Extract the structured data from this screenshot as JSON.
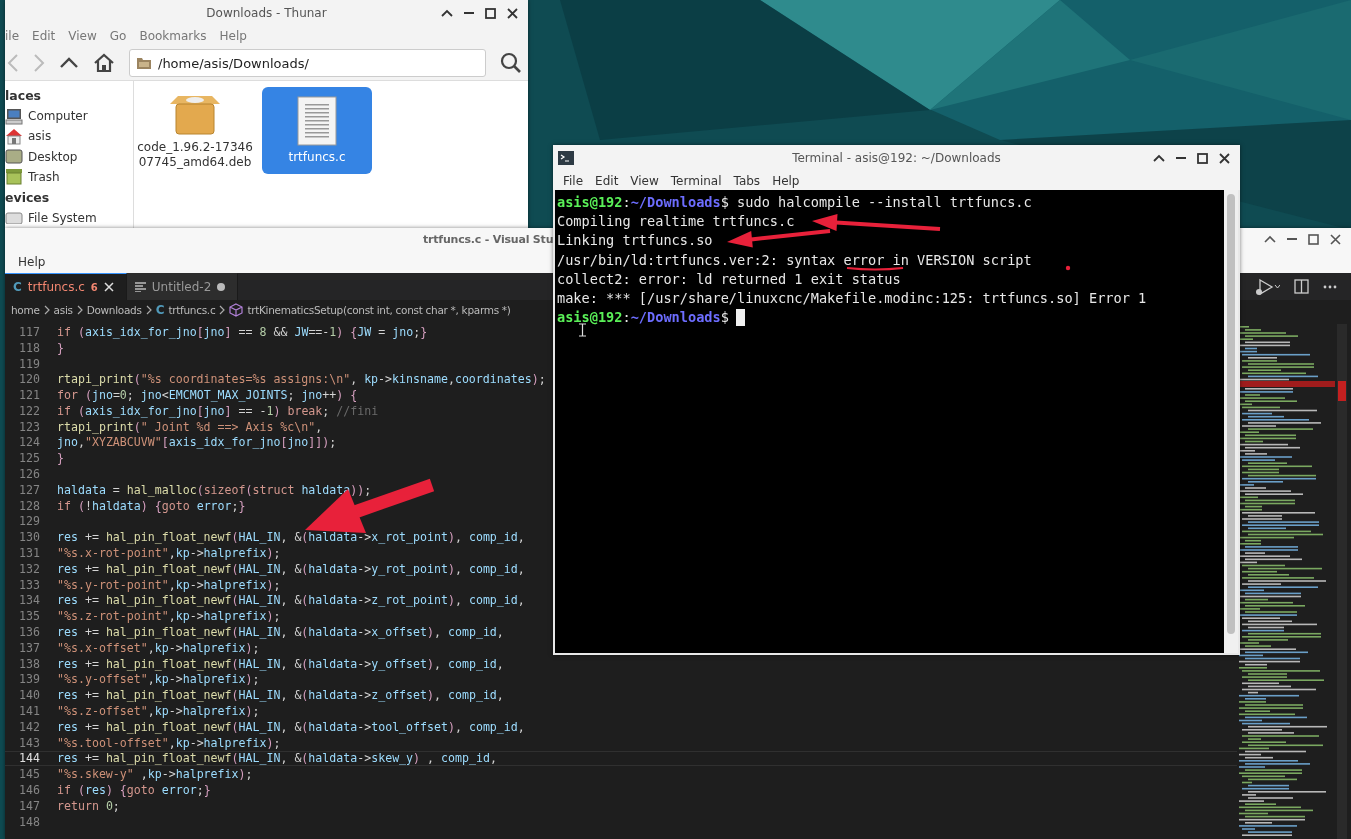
{
  "thunar": {
    "title": "Downloads - Thunar",
    "menu": [
      "ile",
      "Edit",
      "View",
      "Go",
      "Bookmarks",
      "Help"
    ],
    "location": "/home/asis/Downloads/",
    "sidebar": [
      {
        "kind": "header",
        "label": "laces"
      },
      {
        "kind": "item",
        "label": "Computer"
      },
      {
        "kind": "item",
        "label": "asis"
      },
      {
        "kind": "item",
        "label": "Desktop"
      },
      {
        "kind": "item",
        "label": "Trash"
      },
      {
        "kind": "header",
        "label": "evices"
      },
      {
        "kind": "item",
        "label": "File System"
      }
    ],
    "files": [
      {
        "name_lines": [
          "code_1.96.2-17346",
          "07745_amd64.deb"
        ],
        "selected": false
      },
      {
        "name_lines": [
          "trtfuncs.c"
        ],
        "selected": true
      }
    ]
  },
  "vscode": {
    "title": "trtfuncs.c - Visual Stu",
    "menu": [
      "Help"
    ],
    "tabs": [
      {
        "icon_text": "C",
        "label": "trtfuncs.c",
        "badge": "6",
        "selected": true,
        "modified": false
      },
      {
        "label": "Untitled-2",
        "selected": false,
        "modified": true
      }
    ],
    "breadcrumb": [
      {
        "kind": "folder",
        "label": "home"
      },
      {
        "kind": "folder",
        "label": "asis"
      },
      {
        "kind": "folder",
        "label": "Downloads"
      },
      {
        "kind": "file",
        "icon_text": "C",
        "label": "trtfuncs.c"
      },
      {
        "kind": "symbol",
        "label": "trtKinematicsSetup(const int, const char *, kparms *)"
      }
    ],
    "lines": [
      {
        "number": "117",
        "code": "if (axis_idx_for_jno[jno] == 8 && JW==-1) {JW = jno;}",
        "current": false
      },
      {
        "number": "118",
        "code": "}",
        "current": false
      },
      {
        "number": "119",
        "current": false
      },
      {
        "number": "120",
        "code": "rtapi_print(\"%s coordinates=%s assigns:\\n\", kp->kinsname,coordinates);",
        "current": false
      },
      {
        "number": "121",
        "code": "for (jno=0; jno<EMCMOT_MAX_JOINTS; jno++) {",
        "current": false
      },
      {
        "number": "122",
        "code": "if (axis_idx_for_jno[jno] == -1) break; //fini",
        "current": false
      },
      {
        "number": "123",
        "code": "rtapi_print(\" Joint %d ==> Axis %c\\n\",",
        "current": false
      },
      {
        "number": "124",
        "code": "jno,\"XYZABCUVW\"[axis_idx_for_jno[jno]]);",
        "current": false
      },
      {
        "number": "125",
        "code": "}",
        "current": false
      },
      {
        "number": "126",
        "current": false
      },
      {
        "number": "127",
        "code": "haldata = hal_malloc(sizeof(struct haldata));",
        "current": false
      },
      {
        "number": "128",
        "code": "if (!haldata) {goto error;}",
        "current": false
      },
      {
        "number": "129",
        "current": false
      },
      {
        "number": "130",
        "code": "res += hal_pin_float_newf(HAL_IN, &(haldata->x_rot_point), comp_id,",
        "current": false
      },
      {
        "number": "131",
        "code": "\"%s.x-rot-point\",kp->halprefix);",
        "current": false
      },
      {
        "number": "132",
        "code": "res += hal_pin_float_newf(HAL_IN, &(haldata->y_rot_point), comp_id,",
        "current": false
      },
      {
        "number": "133",
        "code": "\"%s.y-rot-point\",kp->halprefix);",
        "current": false
      },
      {
        "number": "134",
        "code": "res += hal_pin_float_newf(HAL_IN, &(haldata->z_rot_point), comp_id,",
        "current": false
      },
      {
        "number": "135",
        "code": "\"%s.z-rot-point\",kp->halprefix);",
        "current": false
      },
      {
        "number": "136",
        "code": "res += hal_pin_float_newf(HAL_IN, &(haldata->x_offset), comp_id,",
        "current": false
      },
      {
        "number": "137",
        "code": "\"%s.x-offset\",kp->halprefix);",
        "current": false
      },
      {
        "number": "138",
        "code": "res += hal_pin_float_newf(HAL_IN, &(haldata->y_offset), comp_id,",
        "current": false
      },
      {
        "number": "139",
        "code": "\"%s.y-offset\",kp->halprefix);",
        "current": false
      },
      {
        "number": "140",
        "code": "res += hal_pin_float_newf(HAL_IN, &(haldata->z_offset), comp_id,",
        "current": false
      },
      {
        "number": "141",
        "code": "\"%s.z-offset\",kp->halprefix);",
        "current": false
      },
      {
        "number": "142",
        "code": "res += hal_pin_float_newf(HAL_IN, &(haldata->tool_offset), comp_id,",
        "current": false
      },
      {
        "number": "143",
        "code": "\"%s.tool-offset\",kp->halprefix);",
        "current": false
      },
      {
        "number": "144",
        "code": "res += hal_pin_float_newf(HAL_IN, &(haldata->skew_y) , comp_id,",
        "current": true
      },
      {
        "number": "145",
        "code": "\"%s.skew-y\" ,kp->halprefix);",
        "current": false
      },
      {
        "number": "146",
        "code": "if (res) {goto error;}",
        "current": false
      },
      {
        "number": "147",
        "code": "return 0;",
        "current": false
      },
      {
        "number": "148",
        "current": false
      }
    ]
  },
  "terminal": {
    "title": "Terminal - asis@192: ~/Downloads",
    "menu": [
      "File",
      "Edit",
      "View",
      "Terminal",
      "Tabs",
      "Help"
    ],
    "lines": [
      {
        "kind": "prompt",
        "user": "asis@192",
        "sep": ":",
        "path": "~/Downloads",
        "symbol": "$",
        "command": "sudo halcompile --install trtfuncs.c",
        "cursor": false
      },
      {
        "kind": "output",
        "text": "Compiling realtime trtfuncs.c"
      },
      {
        "kind": "output",
        "text": "Linking trtfuncs.so"
      },
      {
        "kind": "output",
        "text": "/usr/bin/ld:trtfuncs.ver:2: syntax error in VERSION script"
      },
      {
        "kind": "output",
        "text": "collect2: error: ld returned 1 exit status"
      },
      {
        "kind": "output",
        "text": "make: *** [/usr/share/linuxcnc/Makefile.modinc:125: trtfuncs.so] Error 1"
      },
      {
        "kind": "prompt",
        "user": "asis@192",
        "sep": ":",
        "path": "~/Downloads",
        "symbol": "$",
        "cursor": true
      }
    ]
  }
}
